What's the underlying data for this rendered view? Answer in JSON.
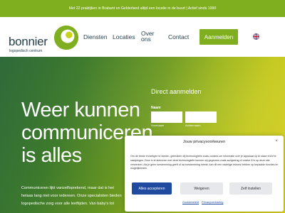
{
  "topbar": {
    "text": "Met 22 praktijken in Brabant en Gelderland altijd een locatie in de buurt | Actief sinds 1990"
  },
  "brand": {
    "name": "bonnier",
    "tagline": "logopedisch centrum",
    "color": "#7fae1f"
  },
  "nav": {
    "items": [
      {
        "label": "Diensten"
      },
      {
        "label": "Locaties"
      },
      {
        "label": "Over\nons"
      },
      {
        "label": "Contact"
      }
    ],
    "cta": "Aanmelden",
    "language_icon": "uk-flag-icon"
  },
  "hero": {
    "title_lines": [
      "Weer kunnen",
      "communiceren",
      "is alles"
    ],
    "body_lines": [
      "Communiceren lijkt vanzelfsprekend, maar dat is het",
      "helaas lang niet voor iedereen. Onze specialisten bieden",
      "logopedische zorg voor alle leeftijden. Van baby's tot"
    ]
  },
  "form": {
    "title": "Direct aanmelden",
    "name_label": "Naam",
    "first_name_sub": "Voornaam",
    "last_name_sub": "Achternaam"
  },
  "cookie": {
    "title": "Jouw privacyvoorkeuren",
    "close": "×",
    "text": "Om de beste ervaringen te bieden, gebruiken wij technologieën zoals cookies om informatie over je apparaat op te slaan en/of te raadplegen. Door in te stemmen met deze technologieën kunnen wij gegevens zoals surfgedrag of unieke ID's op deze site verwerken. Als je geen toestemming geeft of uw toestemming intrekt, kan dit een nadelige invloed hebben op bepaalde functies en mogelijkheden.",
    "accept": "Alles accepteren",
    "deny": "Weigeren",
    "settings": "Zelf instellen",
    "link_cookie": "Cookiebeleid",
    "link_privacy": "Privacyverklaring",
    "accent_color": "#1f4aa0"
  }
}
